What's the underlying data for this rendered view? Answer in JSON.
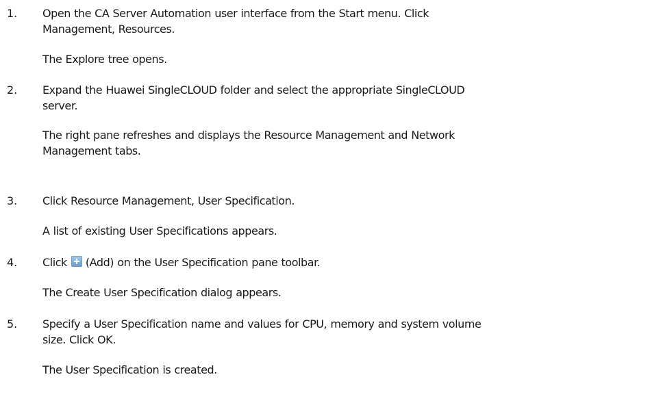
{
  "steps": [
    {
      "number": "1.",
      "lines": [
        "Open the CA Server Automation user interface from the Start menu. Click",
        "Management, Resources."
      ],
      "result": "The Explore tree opens."
    },
    {
      "number": "2.",
      "lines": [
        "Expand the Huawei SingleCLOUD folder and select the appropriate SingleCLOUD",
        "server."
      ],
      "result_lines": [
        "The right pane refreshes and displays the Resource Management and Network",
        "Management tabs."
      ]
    },
    {
      "number": "3.",
      "lines": [
        "Click Resource Management, User Specification."
      ],
      "result": "A list of existing User Specifications appears."
    },
    {
      "number": "4.",
      "line_prefix": "Click",
      "icon": "add-icon",
      "line_suffix": "(Add) on the User Specification pane toolbar.",
      "result": "The Create User Specification dialog appears."
    },
    {
      "number": "5.",
      "lines": [
        "Specify a User Specification name and values for CPU, memory and system volume",
        "size. Click OK."
      ],
      "result": "The User Specification is created."
    }
  ]
}
